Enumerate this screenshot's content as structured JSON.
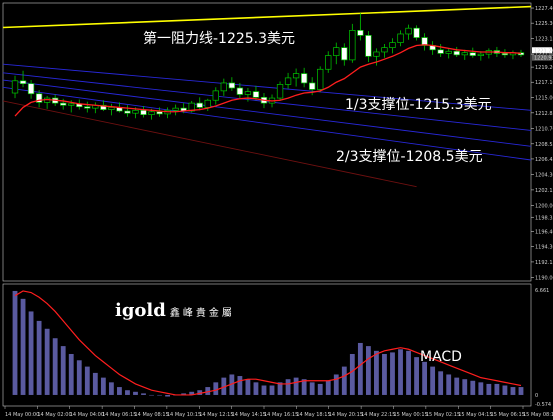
{
  "chart_data": {
    "type": "candlestick",
    "symbol": "XAUUSD",
    "timeframe": "M15",
    "price_axis": {
      "ticks": [
        "1227.40",
        "1225.30",
        "1223.15",
        "1221.00",
        "1219.20",
        "1217.10",
        "1215.00",
        "1212.85",
        "1210.70",
        "1208.55",
        "1206.45",
        "1204.30",
        "1202.15",
        "1200.00",
        "1198.35",
        "1196.40",
        "1194.30",
        "1192.15",
        "1190.00"
      ],
      "ylim": [
        1189.5,
        1228.1
      ]
    },
    "current_price_labels": [
      "1221.26",
      "1220.93"
    ],
    "time_axis_labels": [
      "14 May 00:00",
      "14 May 02:00",
      "14 May 04:00",
      "14 May 06:15",
      "14 May 08:15",
      "14 May 10:15",
      "14 May 12:15",
      "14 May 14:15",
      "14 May 16:15",
      "14 May 18:15",
      "14 May 20:15",
      "14 May 22:15",
      "15 May 00:15",
      "15 May 02:15",
      "15 May 04:15",
      "15 May 06:15",
      "15 May 08:15"
    ],
    "candles": [
      [
        1215.6,
        1218.0,
        1214.9,
        1217.3
      ],
      [
        1217.3,
        1218.7,
        1216.4,
        1216.9
      ],
      [
        1216.9,
        1217.4,
        1214.8,
        1215.5
      ],
      [
        1215.5,
        1216.0,
        1213.6,
        1214.3
      ],
      [
        1214.3,
        1215.2,
        1213.4,
        1214.9
      ],
      [
        1214.9,
        1215.4,
        1213.8,
        1214.2
      ],
      [
        1214.2,
        1214.8,
        1213.3,
        1213.9
      ],
      [
        1213.9,
        1214.6,
        1212.9,
        1214.1
      ],
      [
        1214.1,
        1214.7,
        1213.3,
        1213.7
      ],
      [
        1213.7,
        1214.4,
        1212.9,
        1213.5
      ],
      [
        1213.5,
        1214.3,
        1212.8,
        1213.9
      ],
      [
        1213.9,
        1214.6,
        1213.1,
        1213.3
      ],
      [
        1213.3,
        1214.1,
        1212.5,
        1213.6
      ],
      [
        1213.6,
        1214.3,
        1212.9,
        1213.1
      ],
      [
        1213.1,
        1213.9,
        1212.3,
        1212.8
      ],
      [
        1212.8,
        1213.6,
        1212.1,
        1213.2
      ],
      [
        1213.2,
        1213.8,
        1212.2,
        1212.6
      ],
      [
        1212.6,
        1213.4,
        1211.9,
        1213.0
      ],
      [
        1213.0,
        1213.6,
        1212.3,
        1212.7
      ],
      [
        1212.7,
        1213.6,
        1212.1,
        1213.2
      ],
      [
        1213.2,
        1214.0,
        1212.5,
        1213.5
      ],
      [
        1213.5,
        1214.2,
        1212.8,
        1213.1
      ],
      [
        1213.1,
        1214.5,
        1212.9,
        1214.2
      ],
      [
        1214.2,
        1215.0,
        1213.2,
        1213.6
      ],
      [
        1213.6,
        1214.8,
        1213.1,
        1214.6
      ],
      [
        1214.6,
        1216.4,
        1214.0,
        1215.9
      ],
      [
        1215.9,
        1217.6,
        1215.2,
        1217.0
      ],
      [
        1217.0,
        1217.8,
        1215.9,
        1216.3
      ],
      [
        1216.3,
        1217.0,
        1214.9,
        1215.4
      ],
      [
        1215.4,
        1216.3,
        1214.4,
        1215.8
      ],
      [
        1215.8,
        1216.6,
        1214.6,
        1215.0
      ],
      [
        1215.0,
        1215.6,
        1213.5,
        1214.2
      ],
      [
        1214.2,
        1215.4,
        1213.6,
        1214.9
      ],
      [
        1214.9,
        1217.2,
        1214.5,
        1216.8
      ],
      [
        1216.8,
        1218.4,
        1216.2,
        1217.7
      ],
      [
        1217.7,
        1219.0,
        1216.5,
        1218.3
      ],
      [
        1218.3,
        1219.1,
        1216.4,
        1217.0
      ],
      [
        1217.0,
        1217.8,
        1215.3,
        1216.1
      ],
      [
        1216.1,
        1219.3,
        1215.7,
        1218.9
      ],
      [
        1218.9,
        1221.4,
        1218.4,
        1220.8
      ],
      [
        1220.8,
        1222.6,
        1219.6,
        1221.9
      ],
      [
        1221.9,
        1222.5,
        1219.4,
        1220.2
      ],
      [
        1220.2,
        1225.2,
        1219.8,
        1224.3
      ],
      [
        1224.3,
        1226.7,
        1222.9,
        1223.6
      ],
      [
        1223.6,
        1224.2,
        1219.9,
        1220.7
      ],
      [
        1220.7,
        1221.8,
        1219.4,
        1221.3
      ],
      [
        1221.3,
        1222.4,
        1220.5,
        1221.9
      ],
      [
        1221.9,
        1223.2,
        1221.1,
        1222.6
      ],
      [
        1222.6,
        1224.3,
        1222.1,
        1223.8
      ],
      [
        1223.8,
        1225.1,
        1223.0,
        1224.6
      ],
      [
        1224.6,
        1225.0,
        1222.9,
        1223.3
      ],
      [
        1223.3,
        1223.9,
        1221.5,
        1222.2
      ],
      [
        1222.2,
        1222.8,
        1220.9,
        1221.6
      ],
      [
        1221.6,
        1222.4,
        1220.6,
        1221.1
      ],
      [
        1221.1,
        1221.8,
        1220.4,
        1221.4
      ],
      [
        1221.4,
        1222.0,
        1220.6,
        1220.9
      ],
      [
        1220.9,
        1221.6,
        1220.2,
        1221.2
      ],
      [
        1221.2,
        1221.9,
        1220.5,
        1220.8
      ],
      [
        1220.8,
        1221.4,
        1220.1,
        1221.0
      ],
      [
        1221.0,
        1221.8,
        1220.4,
        1221.5
      ],
      [
        1221.5,
        1222.0,
        1220.6,
        1221.1
      ],
      [
        1221.1,
        1221.7,
        1220.5,
        1220.9
      ],
      [
        1220.9,
        1221.5,
        1220.3,
        1221.2
      ],
      [
        1221.2,
        1221.6,
        1220.6,
        1220.9
      ]
    ],
    "ma": [
      1212.4,
      1213.6,
      1214.3,
      1214.6,
      1214.7,
      1214.6,
      1214.5,
      1214.3,
      1214.1,
      1214.0,
      1213.9,
      1213.8,
      1213.7,
      1213.6,
      1213.5,
      1213.4,
      1213.3,
      1213.2,
      1213.1,
      1213.0,
      1213.0,
      1213.1,
      1213.2,
      1213.3,
      1213.5,
      1213.8,
      1214.2,
      1214.6,
      1214.8,
      1214.9,
      1214.8,
      1214.6,
      1214.5,
      1214.6,
      1214.9,
      1215.3,
      1215.6,
      1215.7,
      1215.9,
      1216.4,
      1217.1,
      1217.6,
      1218.4,
      1219.2,
      1219.6,
      1219.9,
      1220.3,
      1220.7,
      1221.2,
      1221.8,
      1222.2,
      1222.3,
      1222.2,
      1222.0,
      1221.8,
      1221.6,
      1221.5,
      1221.4,
      1221.3,
      1221.3,
      1221.3,
      1221.2,
      1221.2,
      1221.1
    ],
    "lines": [
      {
        "kind": "resistance",
        "color": "#ffff00",
        "from": [
          0,
          1224.7
        ],
        "to": [
          63,
          1227.6
        ]
      },
      {
        "kind": "support",
        "color": "#2828d8",
        "from": [
          0,
          1219.6
        ],
        "to": [
          63,
          1213.2
        ]
      },
      {
        "kind": "support",
        "color": "#2828d8",
        "from": [
          0,
          1218.4
        ],
        "to": [
          63,
          1210.4
        ]
      },
      {
        "kind": "support",
        "color": "#2828d8",
        "from": [
          0,
          1217.4
        ],
        "to": [
          63,
          1208.2
        ]
      },
      {
        "kind": "support",
        "color": "#2828d8",
        "from": [
          0,
          1216.4
        ],
        "to": [
          63,
          1206.3
        ]
      },
      {
        "kind": "trend",
        "color": "#6e1010",
        "from": [
          0,
          1214.5
        ],
        "to": [
          50,
          1202.6
        ]
      }
    ],
    "annotations": [
      "第一阻力线-1225.3美元",
      "1/3支撑位-1215.3美元",
      "2/3支撑位-1208.5美元"
    ],
    "macd": {
      "label": "MACD",
      "axis_ticks": [
        "6.661",
        "0",
        "-0.574"
      ],
      "signal": [
        6.3,
        6.6,
        6.5,
        6.2,
        5.8,
        5.3,
        4.7,
        4.1,
        3.5,
        3.0,
        2.5,
        2.1,
        1.7,
        1.3,
        1.0,
        0.7,
        0.5,
        0.3,
        0.2,
        0.1,
        0.0,
        0.0,
        0.0,
        0.1,
        0.2,
        0.3,
        0.5,
        0.7,
        0.9,
        1.0,
        1.0,
        0.9,
        0.8,
        0.7,
        0.7,
        0.8,
        0.9,
        0.9,
        0.9,
        0.9,
        1.0,
        1.2,
        1.5,
        1.9,
        2.3,
        2.6,
        2.8,
        2.9,
        3.0,
        2.9,
        2.7,
        2.5,
        2.3,
        2.1,
        1.9,
        1.7,
        1.5,
        1.3,
        1.1,
        1.0,
        0.9,
        0.8,
        0.7,
        0.6
      ],
      "histogram": [
        6.6,
        6.1,
        5.3,
        4.7,
        4.2,
        3.6,
        3.1,
        2.6,
        2.2,
        1.8,
        1.4,
        1.1,
        0.8,
        0.5,
        0.3,
        0.2,
        0.1,
        0.0,
        0.0,
        -0.1,
        0.0,
        0.1,
        0.2,
        0.3,
        0.5,
        0.8,
        1.1,
        1.3,
        1.2,
        1.0,
        0.8,
        0.6,
        0.6,
        0.8,
        1.0,
        1.1,
        1.0,
        0.8,
        0.7,
        0.9,
        1.3,
        1.8,
        2.6,
        3.3,
        3.1,
        2.8,
        2.6,
        2.7,
        2.9,
        2.8,
        2.4,
        2.1,
        1.8,
        1.5,
        1.3,
        1.1,
        1.0,
        0.9,
        0.8,
        0.7,
        0.7,
        0.6,
        0.5,
        0.5
      ]
    }
  },
  "logo": {
    "brand": "igold",
    "chinese": "鑫峰貴金屬"
  }
}
